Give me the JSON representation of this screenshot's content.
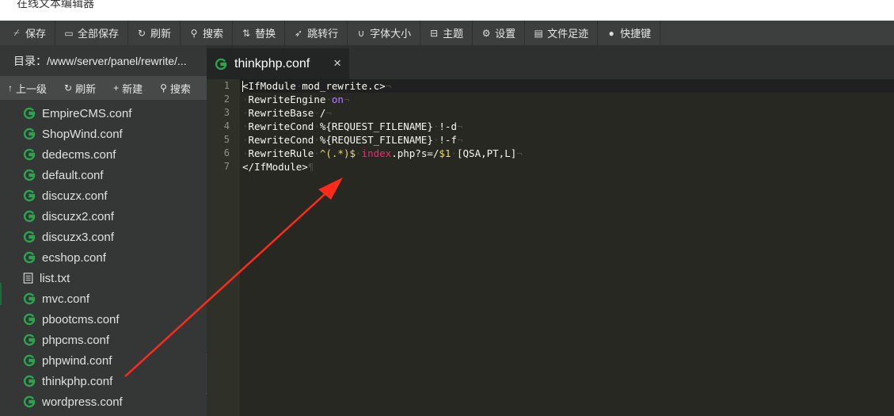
{
  "window": {
    "title": "在线文本编辑器"
  },
  "toolbar": {
    "items": [
      {
        "icon": "save-icon",
        "label": "保存"
      },
      {
        "icon": "save-all-icon",
        "label": "全部保存"
      },
      {
        "icon": "refresh-icon",
        "label": "刷新"
      },
      {
        "icon": "search-icon",
        "label": "搜索"
      },
      {
        "icon": "replace-icon",
        "label": "替换"
      },
      {
        "icon": "goto-line-icon",
        "label": "跳转行"
      },
      {
        "icon": "font-size-icon",
        "label": "字体大小"
      },
      {
        "icon": "theme-icon",
        "label": "主题"
      },
      {
        "icon": "gear-icon",
        "label": "设置"
      },
      {
        "icon": "history-icon",
        "label": "文件足迹"
      },
      {
        "icon": "keyboard-icon",
        "label": "快捷键"
      }
    ]
  },
  "sidebar": {
    "directory_label": "目录：/www/server/panel/rewrite/...",
    "tools": [
      {
        "icon": "arrow-up-icon",
        "label": "上一级"
      },
      {
        "icon": "refresh-icon",
        "label": "刷新"
      },
      {
        "icon": "plus-icon",
        "label": "新建"
      },
      {
        "icon": "search-icon",
        "label": "搜索"
      }
    ],
    "files": [
      {
        "name": "EmpireCMS.conf",
        "icon": "nginx-conf-icon"
      },
      {
        "name": "ShopWind.conf",
        "icon": "nginx-conf-icon"
      },
      {
        "name": "dedecms.conf",
        "icon": "nginx-conf-icon"
      },
      {
        "name": "default.conf",
        "icon": "nginx-conf-icon"
      },
      {
        "name": "discuzx.conf",
        "icon": "nginx-conf-icon"
      },
      {
        "name": "discuzx2.conf",
        "icon": "nginx-conf-icon"
      },
      {
        "name": "discuzx3.conf",
        "icon": "nginx-conf-icon"
      },
      {
        "name": "ecshop.conf",
        "icon": "nginx-conf-icon"
      },
      {
        "name": "list.txt",
        "icon": "text-file-icon"
      },
      {
        "name": "mvc.conf",
        "icon": "nginx-conf-icon"
      },
      {
        "name": "pbootcms.conf",
        "icon": "nginx-conf-icon"
      },
      {
        "name": "phpcms.conf",
        "icon": "nginx-conf-icon"
      },
      {
        "name": "phpwind.conf",
        "icon": "nginx-conf-icon"
      },
      {
        "name": "thinkphp.conf",
        "icon": "nginx-conf-icon"
      },
      {
        "name": "wordpress.conf",
        "icon": "nginx-conf-icon"
      }
    ]
  },
  "editor": {
    "tab": {
      "title": "thinkphp.conf",
      "close": "×"
    },
    "line_numbers": [
      "1",
      "2",
      "3",
      "4",
      "5",
      "6",
      "7"
    ],
    "lines": [
      [
        {
          "t": "<IfModule"
        },
        {
          "t": "·",
          "c": "sp"
        },
        {
          "t": "mod_rewrite.c>"
        },
        {
          "t": "¬",
          "c": "sp"
        }
      ],
      [
        {
          "t": "·",
          "c": "sp"
        },
        {
          "t": "RewriteEngine"
        },
        {
          "t": "·",
          "c": "sp"
        },
        {
          "t": "on",
          "c": "kw"
        },
        {
          "t": "¬",
          "c": "sp"
        }
      ],
      [
        {
          "t": "·",
          "c": "sp"
        },
        {
          "t": "RewriteBase"
        },
        {
          "t": "·",
          "c": "sp"
        },
        {
          "t": "/"
        },
        {
          "t": "¬",
          "c": "sp"
        }
      ],
      [
        {
          "t": "·",
          "c": "sp"
        },
        {
          "t": "RewriteCond"
        },
        {
          "t": "·",
          "c": "sp"
        },
        {
          "t": "%{REQUEST_FILENAME}"
        },
        {
          "t": "·",
          "c": "sp"
        },
        {
          "t": "!-d"
        },
        {
          "t": "¬",
          "c": "sp"
        }
      ],
      [
        {
          "t": "·",
          "c": "sp"
        },
        {
          "t": "RewriteCond"
        },
        {
          "t": "·",
          "c": "sp"
        },
        {
          "t": "%{REQUEST_FILENAME}"
        },
        {
          "t": "·",
          "c": "sp"
        },
        {
          "t": "!-f"
        },
        {
          "t": "¬",
          "c": "sp"
        }
      ],
      [
        {
          "t": "·",
          "c": "sp"
        },
        {
          "t": "RewriteRule"
        },
        {
          "t": "·",
          "c": "sp"
        },
        {
          "t": "^(.*)$",
          "c": "str"
        },
        {
          "t": "·",
          "c": "sp"
        },
        {
          "t": "index",
          "c": "pink"
        },
        {
          "t": ".php?s=/"
        },
        {
          "t": "$1",
          "c": "str"
        },
        {
          "t": "·",
          "c": "sp"
        },
        {
          "t": "[QSA,PT,L]"
        },
        {
          "t": "¬",
          "c": "sp"
        }
      ],
      [
        {
          "t": "</IfModule>"
        },
        {
          "t": "¶",
          "c": "sp"
        }
      ]
    ]
  },
  "colors": {
    "annotation_arrow": "#ff2a1a",
    "conf_icon_green": "#2aa44f"
  }
}
